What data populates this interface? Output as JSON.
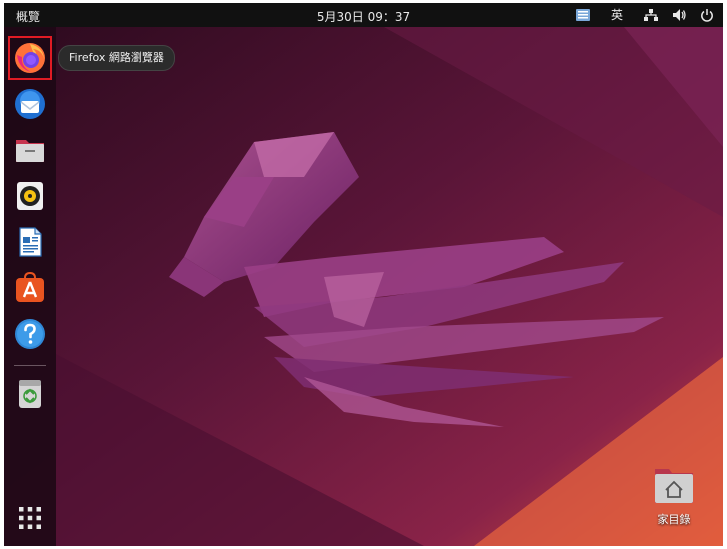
{
  "topbar": {
    "activities_label": "概覽",
    "clock": "5月30日  09：37",
    "ime_label": "英"
  },
  "dock": {
    "items": [
      {
        "name": "firefox",
        "icon": "firefox-icon"
      },
      {
        "name": "thunderbird",
        "icon": "thunderbird-icon"
      },
      {
        "name": "files",
        "icon": "files-icon"
      },
      {
        "name": "rhythmbox",
        "icon": "rhythmbox-icon"
      },
      {
        "name": "libreoffice-writer",
        "icon": "writer-icon"
      },
      {
        "name": "app-center",
        "icon": "app-center-icon"
      },
      {
        "name": "help",
        "icon": "help-icon"
      },
      {
        "name": "trash",
        "icon": "trash-icon"
      },
      {
        "name": "show-applications",
        "icon": "app-grid-icon"
      }
    ]
  },
  "tooltip": {
    "text": "Firefox 網路瀏覽器"
  },
  "desktop": {
    "home_label": "家目錄"
  },
  "colors": {
    "topbar": "#111111",
    "selection_outline": "#e01b24",
    "wallpaper_dark": "#3a0a25",
    "wallpaper_accent": "#e05c3c"
  }
}
